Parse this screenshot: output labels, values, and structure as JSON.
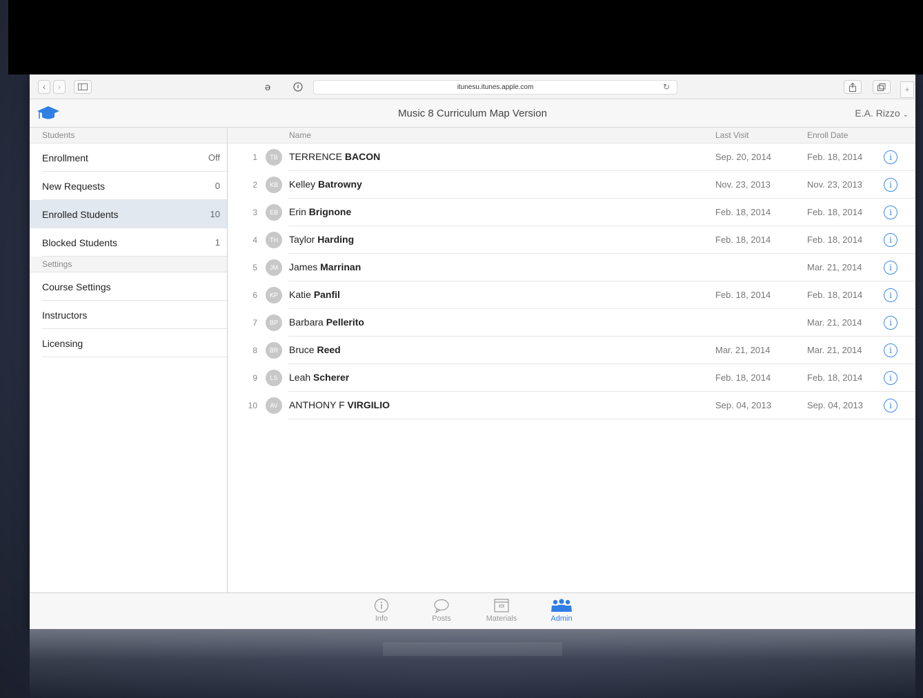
{
  "browser": {
    "url": "itunesu.itunes.apple.com"
  },
  "header": {
    "title": "Music 8 Curriculum Map Version",
    "user": "E.A. Rizzo"
  },
  "sidebar": {
    "students_header": "Students",
    "items": [
      {
        "label": "Enrollment",
        "value": "Off"
      },
      {
        "label": "New Requests",
        "value": "0"
      },
      {
        "label": "Enrolled Students",
        "value": "10"
      },
      {
        "label": "Blocked Students",
        "value": "1"
      }
    ],
    "settings_header": "Settings",
    "settings_items": [
      {
        "label": "Course Settings"
      },
      {
        "label": "Instructors"
      },
      {
        "label": "Licensing"
      }
    ]
  },
  "table": {
    "columns": {
      "name": "Name",
      "last_visit": "Last Visit",
      "enroll_date": "Enroll Date"
    },
    "rows": [
      {
        "num": "1",
        "initials": "TB",
        "first": "TERRENCE",
        "last": "BACON",
        "last_visit": "Sep. 20, 2014",
        "enroll": "Feb. 18, 2014"
      },
      {
        "num": "2",
        "initials": "KB",
        "first": "Kelley",
        "last": "Batrowny",
        "last_visit": "Nov. 23, 2013",
        "enroll": "Nov. 23, 2013"
      },
      {
        "num": "3",
        "initials": "EB",
        "first": "Erin",
        "last": "Brignone",
        "last_visit": "Feb. 18, 2014",
        "enroll": "Feb. 18, 2014"
      },
      {
        "num": "4",
        "initials": "TH",
        "first": "Taylor",
        "last": "Harding",
        "last_visit": "Feb. 18, 2014",
        "enroll": "Feb. 18, 2014"
      },
      {
        "num": "5",
        "initials": "JM",
        "first": "James",
        "last": "Marrinan",
        "last_visit": "",
        "enroll": "Mar. 21, 2014"
      },
      {
        "num": "6",
        "initials": "KP",
        "first": "Katie",
        "last": "Panfil",
        "last_visit": "Feb. 18, 2014",
        "enroll": "Feb. 18, 2014"
      },
      {
        "num": "7",
        "initials": "BP",
        "first": "Barbara",
        "last": "Pellerito",
        "last_visit": "",
        "enroll": "Mar. 21, 2014"
      },
      {
        "num": "8",
        "initials": "BR",
        "first": "Bruce",
        "last": "Reed",
        "last_visit": "Mar. 21, 2014",
        "enroll": "Mar. 21, 2014"
      },
      {
        "num": "9",
        "initials": "LS",
        "first": "Leah",
        "last": "Scherer",
        "last_visit": "Feb. 18, 2014",
        "enroll": "Feb. 18, 2014"
      },
      {
        "num": "10",
        "initials": "AV",
        "first": "ANTHONY F",
        "last": "VIRGILIO",
        "last_visit": "Sep. 04, 2013",
        "enroll": "Sep. 04, 2013"
      }
    ]
  },
  "tabs": [
    {
      "label": "Info",
      "icon": "info-icon"
    },
    {
      "label": "Posts",
      "icon": "speech-bubble-icon"
    },
    {
      "label": "Materials",
      "icon": "box-icon"
    },
    {
      "label": "Admin",
      "icon": "people-icon",
      "active": true
    }
  ],
  "colors": {
    "accent": "#2f7fe4",
    "selected_row": "#e2e8f0"
  }
}
